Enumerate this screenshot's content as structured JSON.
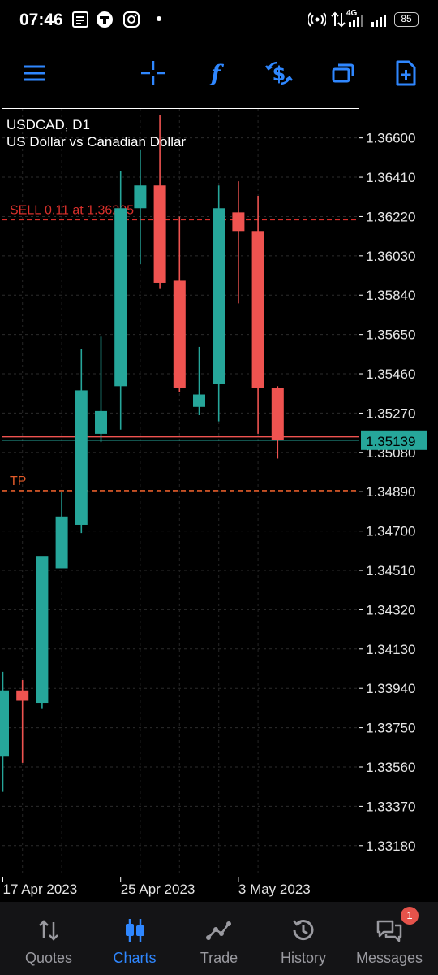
{
  "status_bar": {
    "time": "07:46",
    "network": "4G",
    "battery": "85",
    "icons": [
      "news-icon",
      "store-icon",
      "instagram-icon",
      "dot-icon",
      "hotspot-icon",
      "data-arrows-icon",
      "signal-icon",
      "signal-icon"
    ]
  },
  "toolbar": {
    "items": [
      "menu-icon",
      "crosshair-icon",
      "indicator-f-icon",
      "dollar-refresh-icon",
      "windows-icon",
      "new-document-icon"
    ]
  },
  "chart": {
    "symbol_line": "USDCAD, D1",
    "description": "US Dollar vs Canadian Dollar",
    "current_price": "1.35139",
    "colors": {
      "bull": "#26a69a",
      "bear": "#ef5350",
      "price_line": "#ef5350",
      "tp_line": "#e35b29",
      "accent": "#2f87ff"
    }
  },
  "chart_data": {
    "type": "candlestick",
    "y_ticks": [
      "1.36600",
      "1.36410",
      "1.36220",
      "1.36030",
      "1.35840",
      "1.35650",
      "1.35460",
      "1.35270",
      "1.35080",
      "1.34890",
      "1.34700",
      "1.34510",
      "1.34320",
      "1.34130",
      "1.33940",
      "1.33750",
      "1.33560",
      "1.33370",
      "1.33180"
    ],
    "ylim": [
      1.3303,
      1.3674
    ],
    "x_labels": [
      "17 Apr 2023",
      "25 Apr 2023",
      "3 May 2023"
    ],
    "candles": [
      {
        "o": 1.3361,
        "h": 1.3402,
        "l": 1.3344,
        "c": 1.3393
      },
      {
        "o": 1.3393,
        "h": 1.3398,
        "l": 1.3358,
        "c": 1.3388
      },
      {
        "o": 1.3387,
        "h": 1.3442,
        "l": 1.3384,
        "c": 1.3458
      },
      {
        "o": 1.3452,
        "h": 1.3489,
        "l": 1.3452,
        "c": 1.3477
      },
      {
        "o": 1.3473,
        "h": 1.3558,
        "l": 1.3469,
        "c": 1.3538
      },
      {
        "o": 1.3517,
        "h": 1.3564,
        "l": 1.3513,
        "c": 1.3528
      },
      {
        "o": 1.354,
        "h": 1.3644,
        "l": 1.3519,
        "c": 1.3626
      },
      {
        "o": 1.3626,
        "h": 1.3654,
        "l": 1.3599,
        "c": 1.3637
      },
      {
        "o": 1.3637,
        "h": 1.3671,
        "l": 1.3587,
        "c": 1.359
      },
      {
        "o": 1.3591,
        "h": 1.3622,
        "l": 1.3537,
        "c": 1.3539
      },
      {
        "o": 1.353,
        "h": 1.3559,
        "l": 1.3526,
        "c": 1.3536
      },
      {
        "o": 1.3541,
        "h": 1.3637,
        "l": 1.3523,
        "c": 1.3626
      },
      {
        "o": 1.3624,
        "h": 1.3639,
        "l": 1.358,
        "c": 1.3615
      },
      {
        "o": 1.3615,
        "h": 1.3632,
        "l": 1.3517,
        "c": 1.3539
      },
      {
        "o": 1.3539,
        "h": 1.354,
        "l": 1.3505,
        "c": 1.3514
      }
    ],
    "lines": [
      {
        "label": "SELL 0.11 at 1.36205",
        "price": 1.36205,
        "style": "dashed",
        "color": "#d9302b"
      },
      {
        "label": "TP",
        "price": 1.34895,
        "style": "dashed",
        "color": "#e35b29"
      },
      {
        "label": "",
        "price": 1.35155,
        "style": "solid",
        "color": "#ef5350"
      },
      {
        "label": "",
        "price": 1.35139,
        "style": "solid",
        "color": "#26a69a"
      }
    ]
  },
  "nav": {
    "items": [
      {
        "label": "Quotes",
        "icon": "quotes-arrows-icon"
      },
      {
        "label": "Charts",
        "icon": "charts-candles-icon"
      },
      {
        "label": "Trade",
        "icon": "trade-line-icon"
      },
      {
        "label": "History",
        "icon": "history-clock-icon"
      },
      {
        "label": "Messages",
        "icon": "messages-chat-icon",
        "badge": "1"
      }
    ],
    "active": "Charts"
  }
}
